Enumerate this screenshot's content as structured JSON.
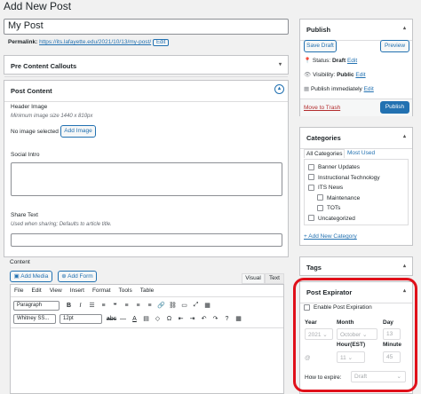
{
  "page": {
    "title": "Add New Post"
  },
  "post": {
    "title_value": "My Post",
    "permalink_label": "Permalink:",
    "permalink_url": "https://its.lafayette.edu/2021/10/13/my-post/",
    "edit_label": "Edit"
  },
  "metaboxes": {
    "pre_content": "Pre Content Callouts",
    "post_content": "Post Content",
    "header_image_label": "Header Image",
    "header_image_hint": "Minimum image size 1440 x 810px",
    "no_image": "No image selected",
    "add_image": "Add Image",
    "social_intro": "Social Intro",
    "share_text": "Share Text",
    "share_hint": "Used when sharing; Defaults to article title.",
    "content": "Content"
  },
  "editor": {
    "add_media": "Add Media",
    "add_form": "Add Form",
    "tab_visual": "Visual",
    "tab_text": "Text",
    "menus": [
      "File",
      "Edit",
      "View",
      "Insert",
      "Format",
      "Tools",
      "Table"
    ],
    "format_select": "Paragraph",
    "font_select": "Whitney SS...",
    "size_select": "12pt"
  },
  "publish": {
    "title": "Publish",
    "save_draft": "Save Draft",
    "preview": "Preview",
    "status_label": "Status:",
    "status_value": "Draft",
    "visibility_label": "Visibility:",
    "visibility_value": "Public",
    "publish_when": "Publish immediately",
    "edit": "Edit",
    "trash": "Move to Trash",
    "publish_btn": "Publish"
  },
  "categories": {
    "title": "Categories",
    "tab_all": "All Categories",
    "tab_used": "Most Used",
    "items": [
      "Banner Updates",
      "Instructional Technology",
      "ITS News",
      "Maintenance",
      "TOTs",
      "Uncategorized"
    ],
    "add_new": "+ Add New Category"
  },
  "tags": {
    "title": "Tags"
  },
  "expirator": {
    "title": "Post Expirator",
    "enable_label": "Enable Post Expiration",
    "year_label": "Year",
    "month_label": "Month",
    "day_label": "Day",
    "year": "2021",
    "month": "October",
    "day": "13",
    "hour_label": "Hour(EST)",
    "minute_label": "Minute",
    "at": "@",
    "hour": "11",
    "minute": "45",
    "how_label": "How to expire:",
    "how_value": "Draft"
  },
  "colors": {
    "accent": "#2271b1",
    "highlight": "#e0101a",
    "trash": "#b32d2e"
  }
}
